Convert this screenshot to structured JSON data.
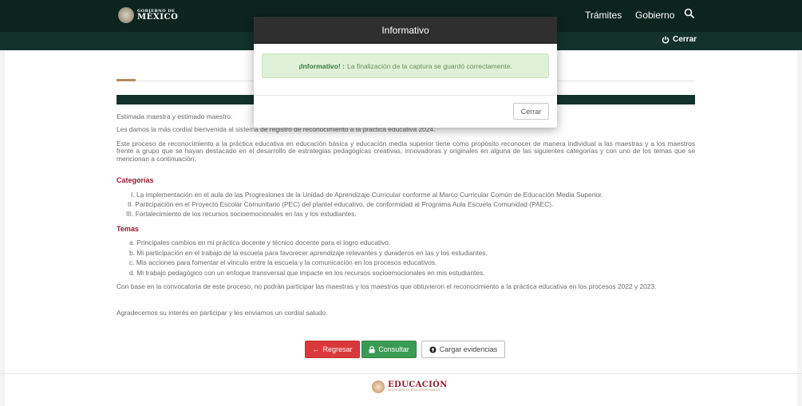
{
  "header": {
    "logo_small": "GOBIERNO DE",
    "logo_big": "MÉXICO",
    "nav": [
      "Trámites",
      "Gobierno"
    ],
    "search_icon": "search-icon",
    "logout_label": "Cerrar"
  },
  "content": {
    "greeting": "Estimada maestra y estimado maestro:",
    "welcome": "Les damos la más cordial bienvenida al sistema de registro de reconocimiento a la práctica educativa 2024.",
    "intro": "Este proceso de reconocimiento a la práctica educativa en educación básica y educación media superior tiene como propósito reconocer de manera individual a las maestras y a los maestros frente a grupo que se hayan destacado en el desarrollo de estrategias pedagógicas creativas, innovadoras y originales en alguna de las siguientes categorías y con uno de los temas que se mencionan a continuación:",
    "categorias_title": "Categorías",
    "categorias": [
      "I. La implementación en el aula de las Progresiones de la Unidad de Aprendizaje Curricular conforme al Marco Curricular Común de Educación Media Superior.",
      "II. Participación en el Proyecto Escolar Comunitario (PEC) del plantel educativo, de conformidad al Programa Aula Escuela Comunidad (PAEC).",
      "III. Fortalecimiento de los recursos socioemocionales en las y los estudiantes."
    ],
    "temas_title": "Temas",
    "temas": [
      "a. Principales cambios en mi práctica docente y técnico docente para el logro educativo.",
      "b. Mi participación en el trabajo de la escuela para favorecer aprendizaje relevantes y duraderos en las y los estudiantes.",
      "c. Mis acciones para fomentar el vínculo entre la escuela y la comunicación en los procesos educativos.",
      "d. Mi trabajo pedagógico con un enfoque transversal que impacte en los recursos socioemocionales en mis estudiantes."
    ],
    "exclusion": "Con base en la convocatoria de este proceso, no podrán participar las maestras y los maestros que obtuvieron el reconocimiento a la práctica educativa en los procesos 2022 y 2023.",
    "closing": "Agradecemos su interés en participar y les enviamos un cordial saludo."
  },
  "buttons": {
    "regresar": "Regresar",
    "consultar": "Consultar",
    "cargar": "Cargar evidencias"
  },
  "footer": {
    "logo_text": "EDUCACIÓN",
    "logo_sub": "SECRETARÍA DE EDUCACIÓN PÚBLICA"
  },
  "modal": {
    "title": "Informativo",
    "alert_label": "¡Informativo! :",
    "alert_message": "La finalización de la captura se guardó correctamente.",
    "close_label": "Cerrar"
  },
  "colors": {
    "header": "#0c231e",
    "subheader": "#13322b",
    "heading_red": "#8f1d2f",
    "alert_bg": "#dff0d8",
    "btn_red": "#d9393a",
    "btn_green": "#3a9b53"
  }
}
